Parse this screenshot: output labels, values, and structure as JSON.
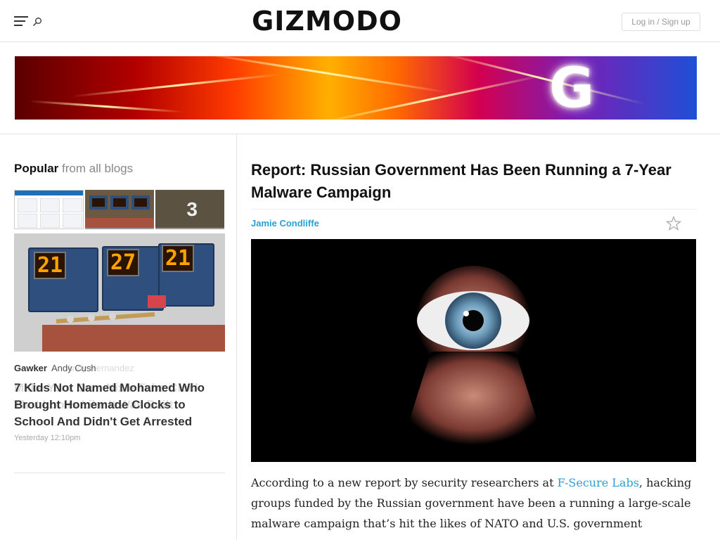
{
  "header": {
    "logo": "GIZMODO",
    "login_label": "Log in / Sign up"
  },
  "sidebar": {
    "popular_label": "Popular",
    "popular_sub": "from all blogs",
    "thumb3_number": "3",
    "card": {
      "blog": "Gawker",
      "author": "Andy Cush",
      "title": "7 Kids Not Named Mohamed Who Brought Homemade Clocks to School And Didn't Get Arrested",
      "time": "Yesterday 12:10pm"
    }
  },
  "article": {
    "headline": "Report: Russian Government Has Been Running a 7-Year Malware Campaign",
    "author": "Jamie Condliffe",
    "body_before_link": "According to a new report by security researchers at ",
    "body_link": "F-Secure Labs",
    "body_after_link": ", hacking groups funded by the Russian government have been a running a large-scale malware campaign that’s hit the likes of NATO and U.S. government"
  },
  "colors": {
    "accent_link": "#2a9fd6",
    "digit_color": "#ffa200"
  },
  "icons": [
    "menu-icon",
    "search-icon",
    "star-icon"
  ]
}
